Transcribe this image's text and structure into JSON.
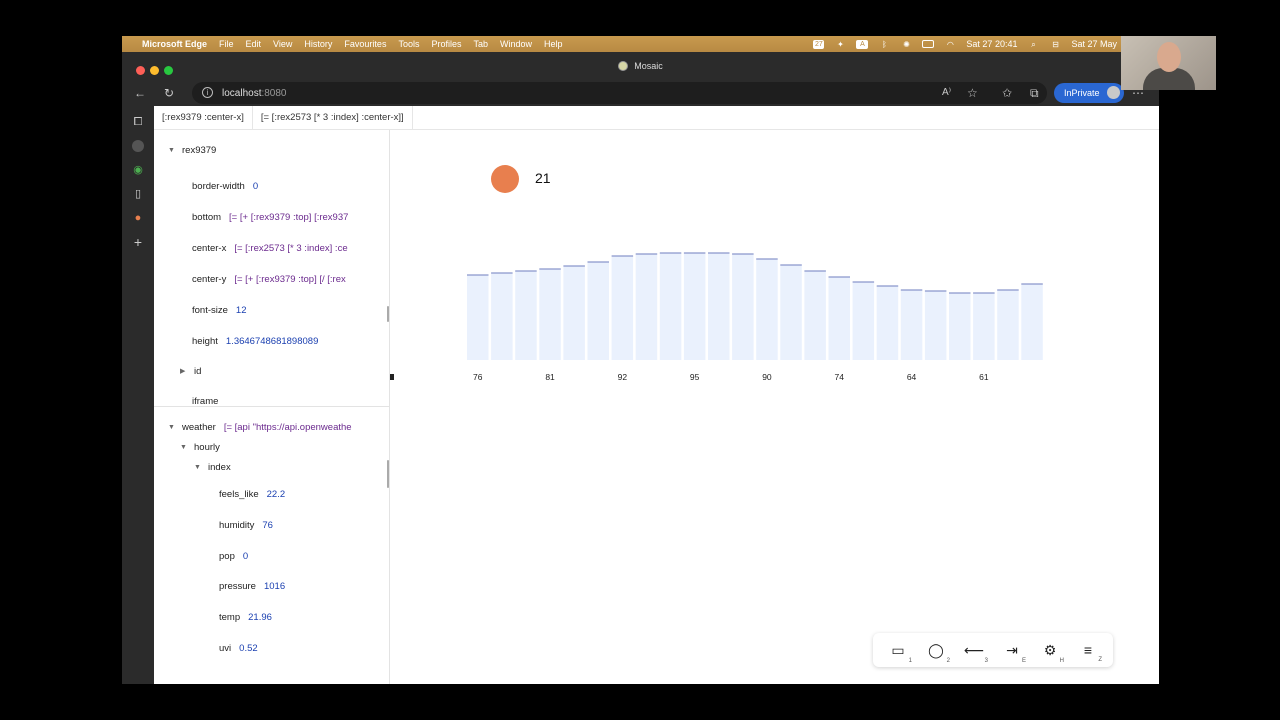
{
  "menubar": {
    "app": "Microsoft Edge",
    "items": [
      "File",
      "Edit",
      "View",
      "History",
      "Favourites",
      "Tools",
      "Profiles",
      "Tab",
      "Window",
      "Help"
    ],
    "clock": "Sat 27  20:41",
    "date": "Sat 27 May",
    "badge": "27"
  },
  "window": {
    "tab_title": "Mosaic"
  },
  "toolbar": {
    "url_host": "localhost",
    "url_port": ":8080",
    "inprivate_label": "InPrivate"
  },
  "breadcrumbs": [
    "[:rex9379 :center-x]",
    "[= [:rex2573 [* 3 :index] :center-x]]"
  ],
  "inspector": {
    "node": "rex9379",
    "props": [
      {
        "key": "border-width",
        "value": "0",
        "kind": "value"
      },
      {
        "key": "bottom",
        "value": "[= [+ [:rex9379 :top] [:rex937",
        "kind": "expr"
      },
      {
        "key": "center-x",
        "value": "[= [:rex2573 [* 3 :index] :ce",
        "kind": "expr"
      },
      {
        "key": "center-y",
        "value": "[= [+ [:rex9379 :top] [/ [:rex",
        "kind": "expr"
      },
      {
        "key": "font-size",
        "value": "12",
        "kind": "value"
      },
      {
        "key": "height",
        "value": "1.3646748681898089",
        "kind": "value"
      }
    ],
    "collapsed": [
      "id"
    ],
    "iframe_label": "iframe"
  },
  "weather": {
    "node": "weather",
    "expr": "[= [api \"https://api.openweathe",
    "hourly": "hourly",
    "index": "index",
    "fields": [
      {
        "key": "feels_like",
        "value": "22.2"
      },
      {
        "key": "humidity",
        "value": "76"
      },
      {
        "key": "pop",
        "value": "0"
      },
      {
        "key": "pressure",
        "value": "1016"
      },
      {
        "key": "temp",
        "value": "21.96"
      },
      {
        "key": "uvi",
        "value": "0.52"
      }
    ]
  },
  "canvas": {
    "temp_value": "21",
    "dot_color": "#e87f4e"
  },
  "chart_data": {
    "type": "bar",
    "values": [
      85,
      87,
      89,
      91,
      94,
      98,
      104,
      106,
      107,
      107,
      107,
      106,
      101,
      95,
      89,
      83,
      78,
      74,
      70,
      69,
      67,
      67,
      70,
      76
    ],
    "tick_labels": [
      "76",
      "81",
      "92",
      "95",
      "90",
      "74",
      "64",
      "61"
    ],
    "ylim": [
      0,
      140
    ],
    "bar_color": "#eaf1fd",
    "bar_top_color": "#8a97cc"
  },
  "toolpanel": {
    "tools": [
      {
        "name": "rectangle-tool",
        "glyph": "▭",
        "key": "1"
      },
      {
        "name": "circle-tool",
        "glyph": "◯",
        "key": "2"
      },
      {
        "name": "arrow-tool",
        "glyph": "⟵",
        "key": "3"
      },
      {
        "name": "text-tool",
        "glyph": "⇥",
        "key": "E"
      },
      {
        "name": "component-tool",
        "glyph": "⚙",
        "key": "H"
      },
      {
        "name": "list-tool",
        "glyph": "≡",
        "key": "Z"
      }
    ]
  }
}
